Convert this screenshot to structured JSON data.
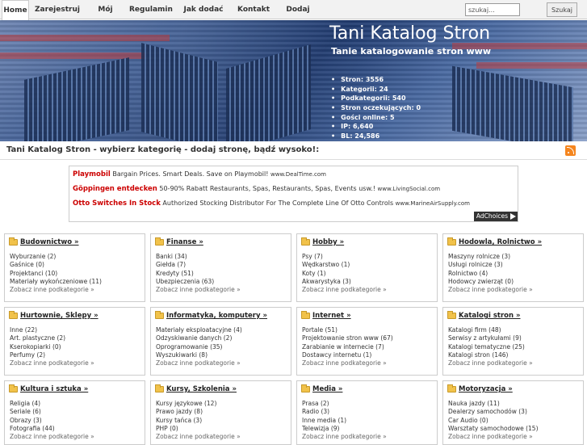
{
  "nav": {
    "items": [
      {
        "label": "Home",
        "active": true
      },
      {
        "label": "Zarejestruj się"
      },
      {
        "label": "Mój panel"
      },
      {
        "label": "Regulamin"
      },
      {
        "label": "Jak dodać wpis?"
      },
      {
        "label": "Kontakt"
      },
      {
        "label": "Dodaj stronę"
      }
    ],
    "search_value": "szukaj...",
    "search_button": "Szukaj"
  },
  "header": {
    "title": "Tani Katalog Stron",
    "subtitle": "Tanie katalogowanie stron www",
    "stats": [
      "Stron: 3556",
      "Kategorii: 24",
      "Podkategorii: 540",
      "Stron oczekujących: 0",
      "Gości online: 5",
      "IP: 6,640",
      "BL: 24,586"
    ]
  },
  "tagline": "Tani Katalog Stron - wybierz kategorię - dodaj stronę, bądź wysoko!:",
  "ads": {
    "items": [
      {
        "title": "Playmobil",
        "text": "Bargain Prices. Smart Deals. Save on Playmobil!",
        "url": "www.DealTime.com"
      },
      {
        "title": "Göppingen entdecken",
        "text": "50-90% Rabatt Restaurants, Spas, Restaurants, Spas, Events usw.!",
        "url": "www.LivingSocial.com"
      },
      {
        "title": "Otto Switches In Stock",
        "text": "Authorized Stocking Distributor For The Complete Line Of Otto Controls",
        "url": "www.MarineAirSupply.com"
      }
    ],
    "choices_label": "AdChoices"
  },
  "more_label": "Zobacz inne podkategorie »",
  "categories": [
    {
      "title": "Budownictwo »",
      "subs": [
        "Wyburzanie (2)",
        "Gaśnice (0)",
        "Projektanci (10)",
        "Materiały wykończeniowe (11)"
      ]
    },
    {
      "title": "Finanse »",
      "subs": [
        "Banki (34)",
        "Giełda (7)",
        "Kredyty (51)",
        "Ubezpieczenia (63)"
      ]
    },
    {
      "title": "Hobby »",
      "subs": [
        "Psy (7)",
        "Wędkarstwo (1)",
        "Koty (1)",
        "Akwarystyka (3)"
      ]
    },
    {
      "title": "Hodowla, Rolnictwo »",
      "subs": [
        "Maszyny rolnicze (3)",
        "Usługi rolnicze (3)",
        "Rolnictwo (4)",
        "Hodowcy zwierząt (0)"
      ]
    },
    {
      "title": "Hurtownie, Sklepy »",
      "subs": [
        "Inne (22)",
        "Art. plastyczne (2)",
        "Kserokopiarki (0)",
        "Perfumy (2)"
      ]
    },
    {
      "title": "Informatyka, komputery »",
      "subs": [
        "Materiały eksploatacyjne (4)",
        "Odzyskiwanie danych (2)",
        "Oprogramowanie (35)",
        "Wyszukiwarki (8)"
      ]
    },
    {
      "title": "Internet »",
      "subs": [
        "Portale (51)",
        "Projektowanie stron www (67)",
        "Zarabianie w internecie (7)",
        "Dostawcy internetu (1)"
      ]
    },
    {
      "title": "Katalogi stron »",
      "subs": [
        "Katalogi firm (48)",
        "Serwisy z artykułami (9)",
        "Katalogi tematyczne (25)",
        "Katalogi stron (146)"
      ]
    },
    {
      "title": "Kultura i sztuka »",
      "subs": [
        "Religia (4)",
        "Seriale (6)",
        "Obrazy (3)",
        "Fotografia (44)"
      ]
    },
    {
      "title": "Kursy, Szkolenia »",
      "subs": [
        "Kursy językowe (12)",
        "Prawo jazdy (8)",
        "Kursy tańca (3)",
        "PHP (0)"
      ]
    },
    {
      "title": "Media »",
      "subs": [
        "Prasa (2)",
        "Radio (3)",
        "Inne media (1)",
        "Telewizja (9)"
      ]
    },
    {
      "title": "Motoryzacja »",
      "subs": [
        "Nauka jazdy (11)",
        "Dealerzy samochodów (3)",
        "Car Audio (0)",
        "Warsztaty samochodowe (15)"
      ]
    }
  ]
}
